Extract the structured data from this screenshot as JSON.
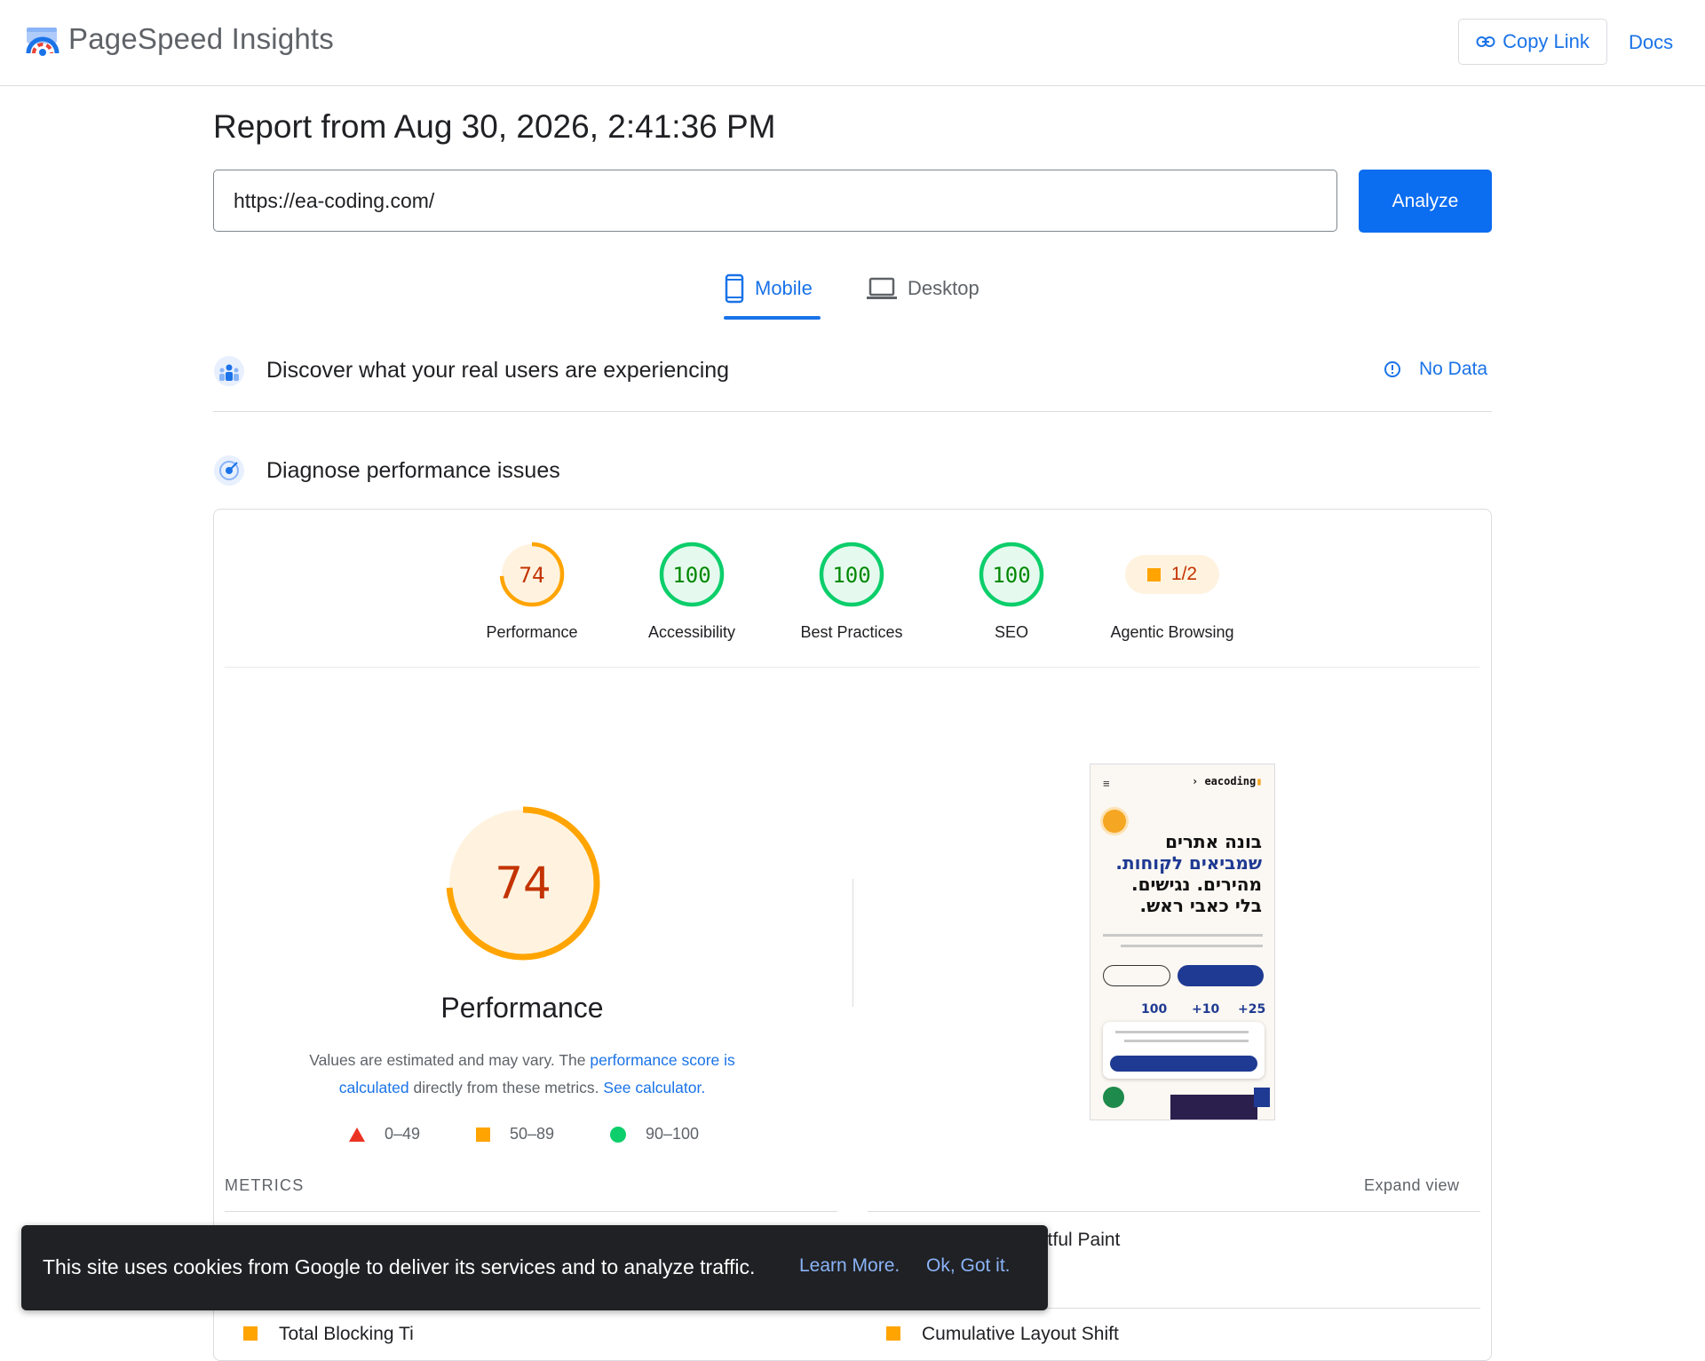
{
  "header": {
    "brand": "PageSpeed Insights",
    "copy_link": "Copy Link",
    "docs": "Docs"
  },
  "report": {
    "title": "Report from Aug 30, 2026, 2:41:36 PM",
    "url": "https://ea-coding.com/",
    "analyze": "Analyze"
  },
  "tabs": {
    "mobile": "Mobile",
    "desktop": "Desktop",
    "active": "Mobile"
  },
  "real_users": {
    "title": "Discover what your real users are experiencing",
    "status": "No Data"
  },
  "diagnose": {
    "title": "Diagnose performance issues"
  },
  "scores": [
    {
      "label": "Performance",
      "value": "74",
      "status": "average"
    },
    {
      "label": "Accessibility",
      "value": "100",
      "status": "pass"
    },
    {
      "label": "Best Practices",
      "value": "100",
      "status": "pass"
    },
    {
      "label": "SEO",
      "value": "100",
      "status": "pass"
    }
  ],
  "agentic": {
    "label": "Agentic Browsing",
    "value": "1/2"
  },
  "performance": {
    "score": "74",
    "title": "Performance",
    "desc_1": "Values are estimated and may vary. The ",
    "link_score": "performance score is calculated",
    "desc_2": " directly from these metrics. ",
    "link_calc": "See calculator."
  },
  "legend": [
    {
      "range": "0–49",
      "shape": "triangle",
      "color": "#eb3323"
    },
    {
      "range": "50–89",
      "shape": "square",
      "color": "#ffa400"
    },
    {
      "range": "90–100",
      "shape": "circle",
      "color": "#0cce6b"
    }
  ],
  "metrics": {
    "label": "METRICS",
    "expand": "Expand view",
    "partial_right_1": "ntful Paint",
    "partial_left_2": "Total Blocking Ti",
    "partial_right_2": "Cumulative Layout Shift"
  },
  "cookie": {
    "text": "This site uses cookies from Google to deliver its services and to analyze traffic.",
    "learn_more": "Learn More.",
    "ok": "Ok, Got it."
  },
  "screenshot": {
    "logo": "eacoding",
    "line1": "בונה אתרים",
    "line2": "שמביאים לקוחות.",
    "line3": "מהירים. נגישים.",
    "line4": "בלי כאבי ראש.",
    "stat1": "100",
    "stat2": "+10",
    "stat3": "+25"
  },
  "colors": {
    "accent": "#1a73e8",
    "average": "#ffa400",
    "average_text": "#c33300",
    "pass": "#0cce6b",
    "pass_text": "#008800"
  }
}
